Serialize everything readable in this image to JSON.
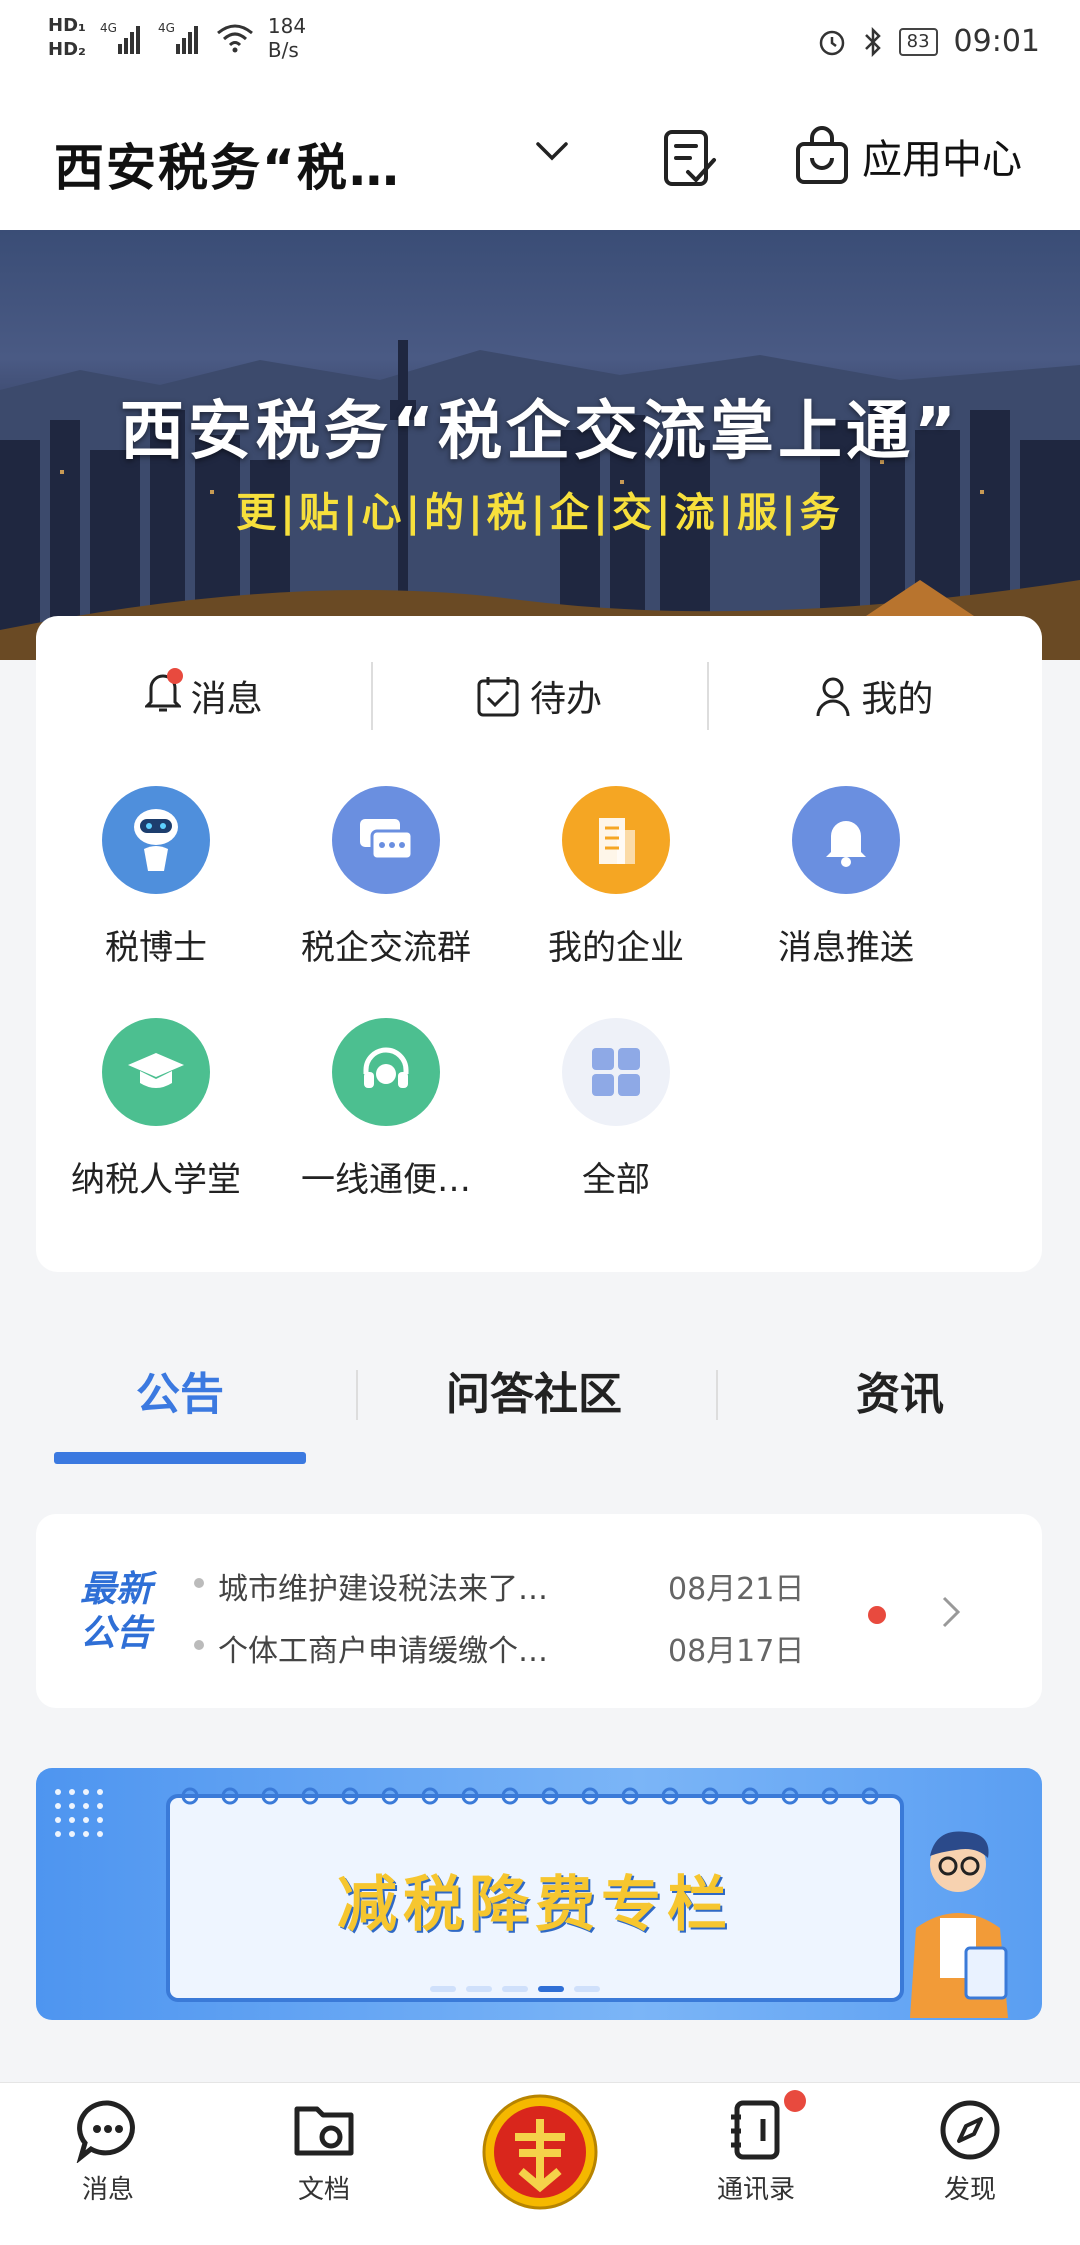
{
  "status_bar": {
    "network": "4G",
    "speed_value": "184",
    "speed_unit": "B/s",
    "battery": "83",
    "time": "09:01"
  },
  "header": {
    "title": "西安税务“税…",
    "app_center_label": "应用中心"
  },
  "banner": {
    "title": "西安税务“税企交流掌上通”",
    "subtitle": "更|贴|心|的|税|企|交|流|服|务"
  },
  "quick_tabs": [
    {
      "label": "消息"
    },
    {
      "label": "待办"
    },
    {
      "label": "我的"
    }
  ],
  "apps": [
    {
      "label": "税博士",
      "color": "#4f8fdc"
    },
    {
      "label": "税企交流群",
      "color": "#6a8fe0"
    },
    {
      "label": "我的企业",
      "color": "#f5a623"
    },
    {
      "label": "消息推送",
      "color": "#6a8fe0"
    },
    {
      "label": "纳税人学堂",
      "color": "#4cbf90"
    },
    {
      "label": "一线通便…",
      "color": "#4cbf90"
    },
    {
      "label": "全部",
      "color": "#eef1f8"
    }
  ],
  "news_tabs": [
    {
      "label": "公告",
      "active": true
    },
    {
      "label": "问答社区",
      "active": false
    },
    {
      "label": "资讯",
      "active": false
    }
  ],
  "notice": {
    "label_line1": "最新",
    "label_line2": "公告",
    "items": [
      {
        "text": "城市维护建设税法来了…",
        "date": "08月21日"
      },
      {
        "text": "个体工商户申请缓缴个…",
        "date": "08月17日"
      }
    ]
  },
  "promo": {
    "title": "减税降费专栏"
  },
  "bottom_nav": [
    {
      "label": "消息"
    },
    {
      "label": "文档"
    },
    {
      "label": ""
    },
    {
      "label": "通讯录"
    },
    {
      "label": "发现"
    }
  ],
  "accent": "#3b79e0"
}
